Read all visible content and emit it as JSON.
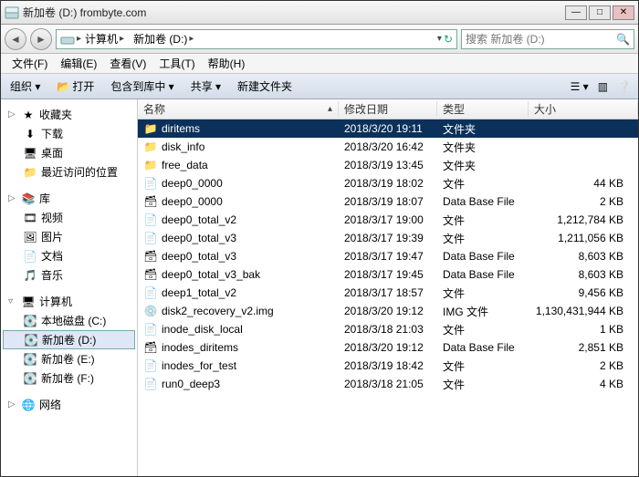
{
  "window": {
    "title": "新加卷 (D:) frombyte.com"
  },
  "nav": {
    "back": "◄",
    "fwd": "►",
    "crumbs": [
      "计算机",
      "新加卷 (D:)"
    ],
    "refresh": "↻",
    "search_placeholder": "搜索 新加卷 (D:)"
  },
  "menu": {
    "items": [
      "文件(F)",
      "编辑(E)",
      "查看(V)",
      "工具(T)",
      "帮助(H)"
    ]
  },
  "toolbar": {
    "organize": "组织 ▾",
    "open": "打开",
    "include": "包含到库中 ▾",
    "share": "共享 ▾",
    "newfolder": "新建文件夹"
  },
  "sidebar": {
    "favorites": {
      "label": "收藏夹",
      "items": [
        "下载",
        "桌面",
        "最近访问的位置"
      ]
    },
    "libraries": {
      "label": "库",
      "items": [
        "视频",
        "图片",
        "文档",
        "音乐"
      ]
    },
    "computer": {
      "label": "计算机",
      "items": [
        "本地磁盘 (C:)",
        "新加卷 (D:)",
        "新加卷 (E:)",
        "新加卷 (F:)"
      ],
      "selected": 1
    },
    "network": {
      "label": "网络"
    }
  },
  "columns": {
    "name": "名称",
    "date": "修改日期",
    "type": "类型",
    "size": "大小"
  },
  "files": [
    {
      "icon": "folder",
      "name": "diritems",
      "date": "2018/3/20 19:11",
      "type": "文件夹",
      "size": "",
      "sel": true
    },
    {
      "icon": "folder",
      "name": "disk_info",
      "date": "2018/3/20 16:42",
      "type": "文件夹",
      "size": ""
    },
    {
      "icon": "folder",
      "name": "free_data",
      "date": "2018/3/19 13:45",
      "type": "文件夹",
      "size": ""
    },
    {
      "icon": "file",
      "name": "deep0_0000",
      "date": "2018/3/19 18:02",
      "type": "文件",
      "size": "44 KB"
    },
    {
      "icon": "db",
      "name": "deep0_0000",
      "date": "2018/3/19 18:07",
      "type": "Data Base File",
      "size": "2 KB"
    },
    {
      "icon": "file",
      "name": "deep0_total_v2",
      "date": "2018/3/17 19:00",
      "type": "文件",
      "size": "1,212,784 KB"
    },
    {
      "icon": "file",
      "name": "deep0_total_v3",
      "date": "2018/3/17 19:39",
      "type": "文件",
      "size": "1,211,056 KB"
    },
    {
      "icon": "db",
      "name": "deep0_total_v3",
      "date": "2018/3/17 19:47",
      "type": "Data Base File",
      "size": "8,603 KB"
    },
    {
      "icon": "db",
      "name": "deep0_total_v3_bak",
      "date": "2018/3/17 19:45",
      "type": "Data Base File",
      "size": "8,603 KB"
    },
    {
      "icon": "file",
      "name": "deep1_total_v2",
      "date": "2018/3/17 18:57",
      "type": "文件",
      "size": "9,456 KB"
    },
    {
      "icon": "img",
      "name": "disk2_recovery_v2.img",
      "date": "2018/3/20 19:12",
      "type": "IMG 文件",
      "size": "1,130,431,944 KB"
    },
    {
      "icon": "file",
      "name": "inode_disk_local",
      "date": "2018/3/18 21:03",
      "type": "文件",
      "size": "1 KB"
    },
    {
      "icon": "db",
      "name": "inodes_diritems",
      "date": "2018/3/20 19:12",
      "type": "Data Base File",
      "size": "2,851 KB"
    },
    {
      "icon": "file",
      "name": "inodes_for_test",
      "date": "2018/3/19 18:42",
      "type": "文件",
      "size": "2 KB"
    },
    {
      "icon": "file",
      "name": "run0_deep3",
      "date": "2018/3/18 21:05",
      "type": "文件",
      "size": "4 KB"
    }
  ]
}
